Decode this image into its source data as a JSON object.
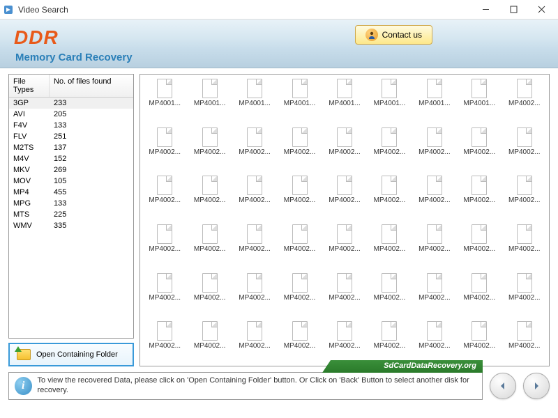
{
  "window": {
    "title": "Video Search"
  },
  "header": {
    "logo": "DDR",
    "subtitle": "Memory Card Recovery",
    "contact_label": "Contact us"
  },
  "filetypes": {
    "col1": "File Types",
    "col2": "No. of files found",
    "rows": [
      {
        "type": "3GP",
        "count": "233"
      },
      {
        "type": "AVI",
        "count": "205"
      },
      {
        "type": "F4V",
        "count": "133"
      },
      {
        "type": "FLV",
        "count": "251"
      },
      {
        "type": "M2TS",
        "count": "137"
      },
      {
        "type": "M4V",
        "count": "152"
      },
      {
        "type": "MKV",
        "count": "269"
      },
      {
        "type": "MOV",
        "count": "105"
      },
      {
        "type": "MP4",
        "count": "455"
      },
      {
        "type": "MPG",
        "count": "133"
      },
      {
        "type": "MTS",
        "count": "225"
      },
      {
        "type": "WMV",
        "count": "335"
      }
    ],
    "selected_index": 0
  },
  "open_folder_label": "Open Containing Folder",
  "files": [
    "MP4001...",
    "MP4001...",
    "MP4001...",
    "MP4001...",
    "MP4001...",
    "MP4001...",
    "MP4001...",
    "MP4001...",
    "MP4002...",
    "MP4002...",
    "MP4002...",
    "MP4002...",
    "MP4002...",
    "MP4002...",
    "MP4002...",
    "MP4002...",
    "MP4002...",
    "MP4002...",
    "MP4002...",
    "MP4002...",
    "MP4002...",
    "MP4002...",
    "MP4002...",
    "MP4002...",
    "MP4002...",
    "MP4002...",
    "MP4002...",
    "MP4002...",
    "MP4002...",
    "MP4002...",
    "MP4002...",
    "MP4002...",
    "MP4002...",
    "MP4002...",
    "MP4002...",
    "MP4002...",
    "MP4002...",
    "MP4002...",
    "MP4002...",
    "MP4002...",
    "MP4002...",
    "MP4002...",
    "MP4002...",
    "MP4002...",
    "MP4002...",
    "MP4002...",
    "MP4002...",
    "MP4002...",
    "MP4002...",
    "MP4002...",
    "MP4002...",
    "MP4002...",
    "MP4002...",
    "MP4002..."
  ],
  "footer": {
    "brand": "SdCardDataRecovery.org",
    "info_text": "To view the recovered Data, please click on 'Open Containing Folder' button. Or Click on 'Back' Button to select another disk for recovery."
  }
}
